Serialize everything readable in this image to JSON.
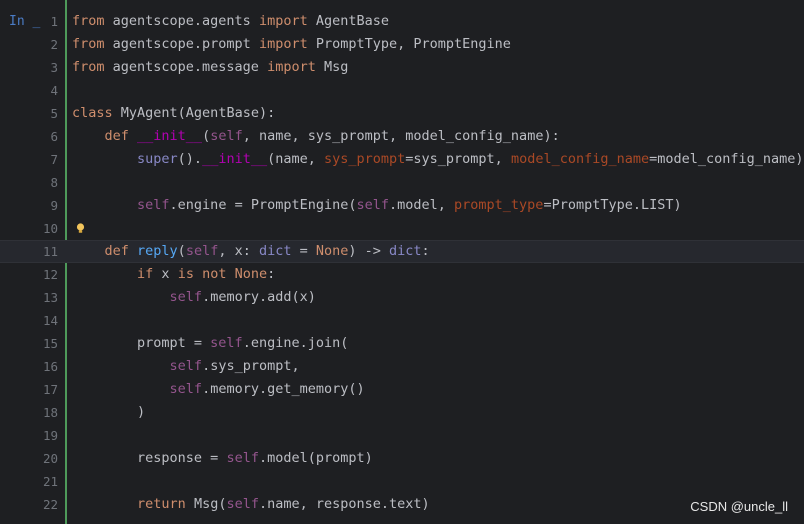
{
  "prompt": "In _",
  "current_line": 11,
  "watermark": "CSDN @uncle_ll",
  "lines": [
    {
      "n": "1",
      "tokens": [
        [
          "kw",
          "from "
        ],
        [
          "txt",
          "agentscope.agents "
        ],
        [
          "kw",
          "import "
        ],
        [
          "txt",
          "AgentBase"
        ]
      ]
    },
    {
      "n": "2",
      "tokens": [
        [
          "kw",
          "from "
        ],
        [
          "txt",
          "agentscope.prompt "
        ],
        [
          "kw",
          "import "
        ],
        [
          "txt",
          "PromptType, PromptEngine"
        ]
      ]
    },
    {
      "n": "3",
      "tokens": [
        [
          "kw",
          "from "
        ],
        [
          "txt",
          "agentscope.message "
        ],
        [
          "kw",
          "import "
        ],
        [
          "txt",
          "Msg"
        ]
      ]
    },
    {
      "n": "4",
      "tokens": []
    },
    {
      "n": "5",
      "tokens": [
        [
          "kw",
          "class "
        ],
        [
          "txt",
          "MyAgent(AgentBase):"
        ]
      ]
    },
    {
      "n": "6",
      "tokens": [
        [
          "txt",
          "    "
        ],
        [
          "kw",
          "def "
        ],
        [
          "dunder",
          "__init__"
        ],
        [
          "txt",
          "("
        ],
        [
          "self",
          "self"
        ],
        [
          "txt",
          ", name, sys_prompt, model_config_name):"
        ]
      ]
    },
    {
      "n": "7",
      "tokens": [
        [
          "txt",
          "        "
        ],
        [
          "bi",
          "super"
        ],
        [
          "txt",
          "()."
        ],
        [
          "dunder",
          "__init__"
        ],
        [
          "txt",
          "(name, "
        ],
        [
          "param",
          "sys_prompt"
        ],
        [
          "txt",
          "=sys_prompt, "
        ],
        [
          "param",
          "model_config_name"
        ],
        [
          "txt",
          "=model_config_name)"
        ]
      ]
    },
    {
      "n": "8",
      "tokens": []
    },
    {
      "n": "9",
      "tokens": [
        [
          "txt",
          "        "
        ],
        [
          "self",
          "self"
        ],
        [
          "txt",
          ".engine = PromptEngine("
        ],
        [
          "self",
          "self"
        ],
        [
          "txt",
          ".model, "
        ],
        [
          "param",
          "prompt_type"
        ],
        [
          "txt",
          "=PromptType.LIST)"
        ]
      ]
    },
    {
      "n": "10",
      "tokens": []
    },
    {
      "n": "11",
      "tokens": [
        [
          "txt",
          "    "
        ],
        [
          "kw",
          "def "
        ],
        [
          "fn",
          "reply"
        ],
        [
          "txt",
          "("
        ],
        [
          "self",
          "self"
        ],
        [
          "txt",
          ", x: "
        ],
        [
          "bi",
          "dict"
        ],
        [
          "txt",
          " = "
        ],
        [
          "kw",
          "None"
        ],
        [
          "txt",
          ") -> "
        ],
        [
          "bi",
          "dict"
        ],
        [
          "txt",
          ":"
        ]
      ]
    },
    {
      "n": "12",
      "tokens": [
        [
          "txt",
          "        "
        ],
        [
          "kw",
          "if "
        ],
        [
          "txt",
          "x "
        ],
        [
          "kw",
          "is not None"
        ],
        [
          "txt",
          ":"
        ]
      ]
    },
    {
      "n": "13",
      "tokens": [
        [
          "txt",
          "            "
        ],
        [
          "self",
          "self"
        ],
        [
          "txt",
          ".memory.add(x)"
        ]
      ]
    },
    {
      "n": "14",
      "tokens": []
    },
    {
      "n": "15",
      "tokens": [
        [
          "txt",
          "        prompt = "
        ],
        [
          "self",
          "self"
        ],
        [
          "txt",
          ".engine.join("
        ]
      ]
    },
    {
      "n": "16",
      "tokens": [
        [
          "txt",
          "            "
        ],
        [
          "self",
          "self"
        ],
        [
          "txt",
          ".sys_prompt,"
        ]
      ]
    },
    {
      "n": "17",
      "tokens": [
        [
          "txt",
          "            "
        ],
        [
          "self",
          "self"
        ],
        [
          "txt",
          ".memory.get_memory()"
        ]
      ]
    },
    {
      "n": "18",
      "tokens": [
        [
          "txt",
          "        )"
        ]
      ]
    },
    {
      "n": "19",
      "tokens": []
    },
    {
      "n": "20",
      "tokens": [
        [
          "txt",
          "        response = "
        ],
        [
          "self",
          "self"
        ],
        [
          "txt",
          ".model(prompt)"
        ]
      ]
    },
    {
      "n": "21",
      "tokens": []
    },
    {
      "n": "22",
      "tokens": [
        [
          "txt",
          "        "
        ],
        [
          "kw",
          "return "
        ],
        [
          "txt",
          "Msg("
        ],
        [
          "self",
          "self"
        ],
        [
          "txt",
          ".name, response.text)"
        ]
      ]
    }
  ],
  "icons": {
    "hint": "lightbulb-icon"
  },
  "colors": {
    "keyword": "#cf8e6d",
    "self": "#94558d",
    "param": "#aa4926",
    "dunder": "#b200b2",
    "function": "#56a8f5",
    "builtin": "#8888c6",
    "text": "#bcbec4",
    "gutter_bar": "#4e9a5a"
  }
}
